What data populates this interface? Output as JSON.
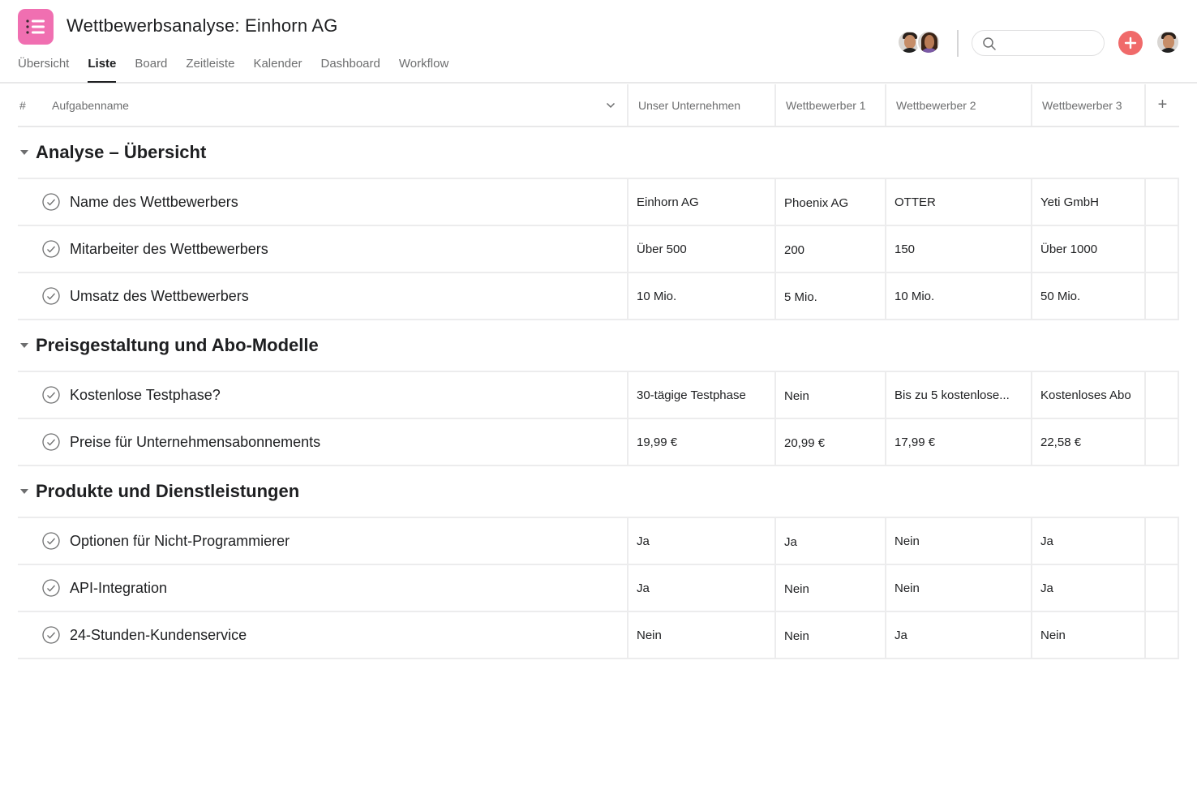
{
  "header": {
    "title": "Wettbewerbsanalyse: Einhorn AG",
    "app_icon": "list-icon",
    "app_icon_color": "#f06fb1",
    "tabs": [
      {
        "label": "Übersicht",
        "active": false
      },
      {
        "label": "Liste",
        "active": true
      },
      {
        "label": "Board",
        "active": false
      },
      {
        "label": "Zeitleiste",
        "active": false
      },
      {
        "label": "Kalender",
        "active": false
      },
      {
        "label": "Dashboard",
        "active": false
      },
      {
        "label": "Workflow",
        "active": false
      }
    ],
    "search": {
      "value": "",
      "placeholder": ""
    },
    "add_button_color": "#f06a6a"
  },
  "table": {
    "columns": {
      "hash": "#",
      "name": "Aufgabenname",
      "c1": "Unser Unternehmen",
      "c2": "Wettbewerber 1",
      "c3": "Wettbewerber 2",
      "c4": "Wettbewerber 3",
      "add": "+"
    },
    "sections": [
      {
        "title": "Analyse – Übersicht",
        "rows": [
          {
            "name": "Name des Wettbewerbers",
            "values": [
              "Einhorn AG",
              "Phoenix AG",
              "OTTER",
              "Yeti GmbH"
            ]
          },
          {
            "name": "Mitarbeiter des Wettbewerbers",
            "values": [
              "Über 500",
              "200",
              "150",
              "Über 1000"
            ]
          },
          {
            "name": "Umsatz des Wettbewerbers",
            "values": [
              "10 Mio.",
              "5 Mio.",
              "10 Mio.",
              "50 Mio."
            ]
          }
        ]
      },
      {
        "title": "Preisgestaltung und Abo-Modelle",
        "rows": [
          {
            "name": "Kostenlose Testphase?",
            "values": [
              "30-tägige Testphase",
              "Nein",
              "Bis zu 5 kostenlose...",
              "Kostenloses Abo"
            ]
          },
          {
            "name": "Preise für Unternehmensabonnements",
            "values": [
              "19,99 €",
              "20,99 €",
              "17,99 €",
              "22,58 €"
            ]
          }
        ]
      },
      {
        "title": "Produkte und Dienstleistungen",
        "rows": [
          {
            "name": "Optionen für Nicht-Programmierer",
            "values": [
              "Ja",
              "Ja",
              "Nein",
              "Ja"
            ]
          },
          {
            "name": "API-Integration",
            "values": [
              "Ja",
              "Nein",
              "Nein",
              "Ja"
            ]
          },
          {
            "name": "24-Stunden-Kundenservice",
            "values": [
              "Nein",
              "Nein",
              "Ja",
              "Nein"
            ]
          }
        ]
      }
    ]
  }
}
